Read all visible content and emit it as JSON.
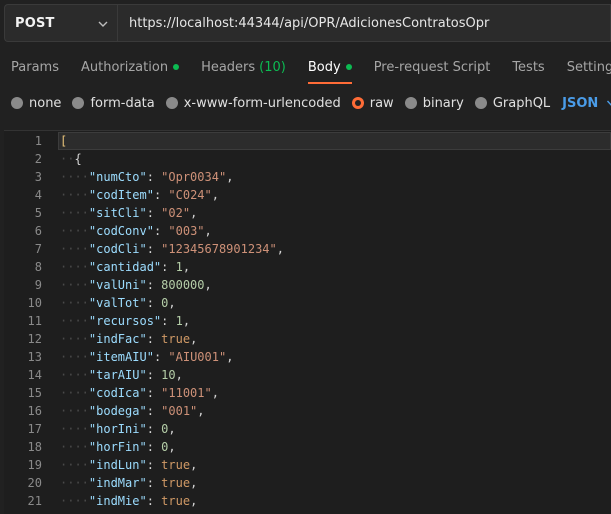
{
  "request": {
    "method": "POST",
    "url": "https://localhost:44344/api/OPR/AdicionesContratosOpr"
  },
  "tabs": [
    {
      "label": "Params",
      "active": false
    },
    {
      "label": "Authorization",
      "active": false,
      "dot": true
    },
    {
      "label": "Headers",
      "active": false,
      "count": "(10)"
    },
    {
      "label": "Body",
      "active": true,
      "dot": true
    },
    {
      "label": "Pre-request Script",
      "active": false
    },
    {
      "label": "Tests",
      "active": false
    },
    {
      "label": "Settings",
      "active": false
    }
  ],
  "body_types": [
    {
      "label": "none",
      "selected": false
    },
    {
      "label": "form-data",
      "selected": false
    },
    {
      "label": "x-www-form-urlencoded",
      "selected": false
    },
    {
      "label": "raw",
      "selected": true
    },
    {
      "label": "binary",
      "selected": false
    },
    {
      "label": "GraphQL",
      "selected": false
    }
  ],
  "format": "JSON",
  "editor": {
    "lines": [
      {
        "num": "1",
        "text": "["
      },
      {
        "num": "2",
        "text": "{"
      },
      {
        "num": "3",
        "key": "\"numCto\"",
        "value": "\"Opr0034\"",
        "type": "s"
      },
      {
        "num": "4",
        "key": "\"codItem\"",
        "value": "\"C024\"",
        "type": "s"
      },
      {
        "num": "5",
        "key": "\"sitCli\"",
        "value": "\"02\"",
        "type": "s"
      },
      {
        "num": "6",
        "key": "\"codConv\"",
        "value": "\"003\"",
        "type": "s"
      },
      {
        "num": "7",
        "key": "\"codCli\"",
        "value": "\"12345678901234\"",
        "type": "s"
      },
      {
        "num": "8",
        "key": "\"cantidad\"",
        "value": "1",
        "type": "n"
      },
      {
        "num": "9",
        "key": "\"valUni\"",
        "value": "800000",
        "type": "n"
      },
      {
        "num": "10",
        "key": "\"valTot\"",
        "value": "0",
        "type": "n"
      },
      {
        "num": "11",
        "key": "\"recursos\"",
        "value": "1",
        "type": "n"
      },
      {
        "num": "12",
        "key": "\"indFac\"",
        "value": "true",
        "type": "b"
      },
      {
        "num": "13",
        "key": "\"itemAIU\"",
        "value": "\"AIU001\"",
        "type": "s"
      },
      {
        "num": "14",
        "key": "\"tarAIU\"",
        "value": "10",
        "type": "n"
      },
      {
        "num": "15",
        "key": "\"codIca\"",
        "value": "\"11001\"",
        "type": "s"
      },
      {
        "num": "16",
        "key": "\"bodega\"",
        "value": "\"001\"",
        "type": "s"
      },
      {
        "num": "17",
        "key": "\"horIni\"",
        "value": "0",
        "type": "n"
      },
      {
        "num": "18",
        "key": "\"horFin\"",
        "value": "0",
        "type": "n"
      },
      {
        "num": "19",
        "key": "\"indLun\"",
        "value": "true",
        "type": "b"
      },
      {
        "num": "20",
        "key": "\"indMar\"",
        "value": "true",
        "type": "b"
      },
      {
        "num": "21",
        "key": "\"indMie\"",
        "value": "true",
        "type": "b"
      }
    ]
  },
  "colors": {
    "accent": "#ff6c37",
    "status_dot": "#0cbb52",
    "format_link": "#4a9ce8"
  },
  "icons": {
    "method_dropdown": "chevron-down-icon",
    "format_dropdown": "chevron-down-icon"
  }
}
